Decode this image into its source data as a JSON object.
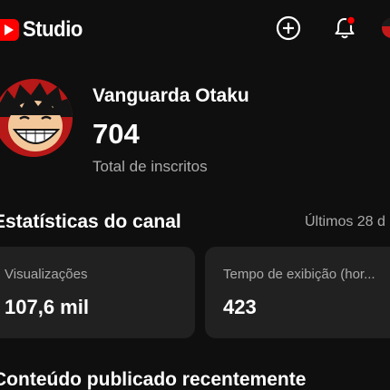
{
  "header": {
    "logo_text": "Studio",
    "icons": [
      "create-icon",
      "notification-bell-icon",
      "account-avatar"
    ],
    "notification_dot_color": "#ff0000"
  },
  "channel": {
    "name": "Vanguarda Otaku",
    "subscriber_count": "704",
    "subscriber_label": "Total de inscritos"
  },
  "stats": {
    "title": "Estatísticas do canal",
    "period": "Últimos 28 d",
    "cards": [
      {
        "label": "Visualizações",
        "value": "107,6 mil"
      },
      {
        "label": "Tempo de exibição (hor...",
        "value": "423"
      }
    ]
  },
  "recent": {
    "title": "Conteúdo publicado recentemente"
  },
  "colors": {
    "background": "#0f0f0f",
    "card": "#212121",
    "brand_red": "#ff0000",
    "secondary_text": "#aaaaaa"
  }
}
